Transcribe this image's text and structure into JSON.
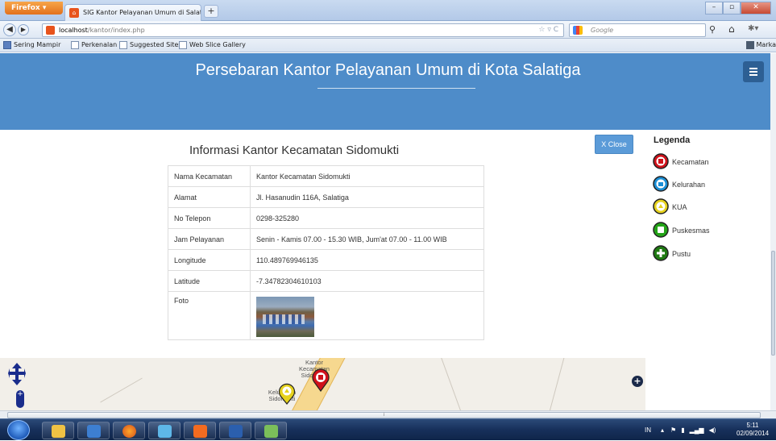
{
  "browser": {
    "menu_label": "Firefox",
    "tab_title": "SIG Kantor Pelayanan Umum di Salatiga",
    "newtab_label": "+",
    "url_host": "localhost",
    "url_path": "/kantor/index.php",
    "search_placeholder": "Google",
    "bookmarks": [
      "Sering Mampir",
      "Perkenalan",
      "Suggested Sites",
      "Web Slice Gallery"
    ],
    "bookmarks_right": "Marka"
  },
  "header": {
    "title": "Persebaran Kantor Pelayanan Umum di Kota Salatiga"
  },
  "info": {
    "title": "Informasi Kantor Kecamatan Sidomukti",
    "close_label": "X Close",
    "rows": [
      {
        "label": "Nama Kecamatan",
        "value": "Kantor Kecamatan Sidomukti"
      },
      {
        "label": "Alamat",
        "value": "Jl. Hasanudin 116A, Salatiga"
      },
      {
        "label": "No Telepon",
        "value": "0298-325280"
      },
      {
        "label": "Jam Pelayanan",
        "value": "Senin - Kamis 07.00 - 15.30 WIB, Jum'at 07.00 - 11.00 WIB"
      },
      {
        "label": "Longitude",
        "value": "110.489769946135"
      },
      {
        "label": "Latitude",
        "value": "-7.34782304610103"
      }
    ],
    "photo_label": "Foto"
  },
  "legend": {
    "title": "Legenda",
    "items": [
      {
        "label": "Kecamatan",
        "color": "#d0121b",
        "icon": "building-marker-icon"
      },
      {
        "label": "Kelurahan",
        "color": "#1b8fd6",
        "icon": "museum-marker-icon"
      },
      {
        "label": "KUA",
        "color": "#e6d21c",
        "icon": "kua-marker-icon"
      },
      {
        "label": "Puskesmas",
        "color": "#23a317",
        "icon": "puskesmas-marker-icon"
      },
      {
        "label": "Pustu",
        "color": "#1f7a12",
        "icon": "pustu-marker-icon"
      }
    ]
  },
  "map": {
    "label_kecamatan_1": "Kantor",
    "label_kecamatan_2": "Kecamatan",
    "label_kecamatan_3": "Sidomukti",
    "label_kelurahan_1": "Kelurahan",
    "label_kelurahan_2": "Sidomukti"
  },
  "taskbar": {
    "tray_lang": "IN",
    "time": "5:11",
    "date": "02/09/2014"
  }
}
